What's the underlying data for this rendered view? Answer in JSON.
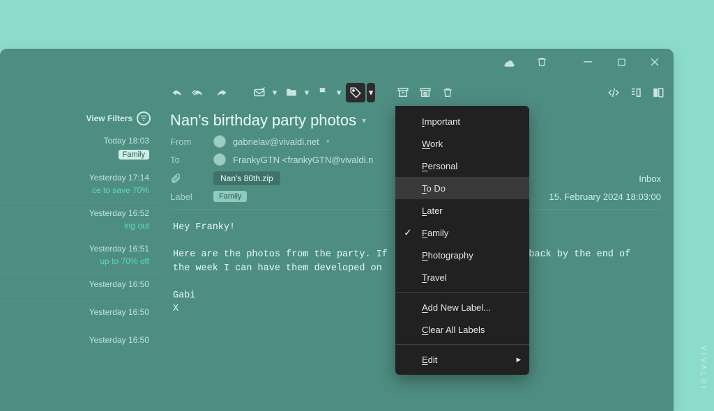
{
  "brand": "VIVALDI",
  "sidebar": {
    "filters_label": "View Filters",
    "items": [
      {
        "time": "Today 18:03",
        "tag": "Family",
        "snippet": ""
      },
      {
        "time": "Yesterday 17:14",
        "tag": "",
        "snippet": "ce to save 70%"
      },
      {
        "time": "Yesterday 16:52",
        "tag": "",
        "snippet": "ing out"
      },
      {
        "time": "Yesterday 16:51",
        "tag": "",
        "snippet": "up to 70% off"
      },
      {
        "time": "Yesterday 16:50",
        "tag": "",
        "snippet": ""
      },
      {
        "time": "Yesterday 16:50",
        "tag": "",
        "snippet": ""
      },
      {
        "time": "Yesterday 16:50",
        "tag": "",
        "snippet": ""
      }
    ]
  },
  "reader": {
    "subject": "Nan's birthday party photos",
    "from_label": "From",
    "from_value": "gabrielav@vivaldi.net",
    "to_label": "To",
    "to_value": "FrankyGTN <frankyGTN@vivaldi.n",
    "attach_name": "Nan's 80th.zip",
    "label_label": "Label",
    "label_value": "Family",
    "folder": "Inbox",
    "date": "15. February 2024 18:03:00",
    "body": "Hey Franky!\n\nHere are the photos from the party. If                         back by the end of\nthe week I can have them developed on\n\nGabi\nX"
  },
  "menu": {
    "items": [
      {
        "key": "I",
        "rest": "mportant"
      },
      {
        "key": "W",
        "rest": "ork"
      },
      {
        "key": "P",
        "rest": "ersonal"
      },
      {
        "key": "T",
        "rest": "o Do",
        "hover": true
      },
      {
        "key": "L",
        "rest": "ater"
      },
      {
        "key": "F",
        "rest": "amily",
        "checked": true
      },
      {
        "key": "P",
        "rest": "hotography"
      },
      {
        "key": "T",
        "rest": "ravel"
      }
    ],
    "add_label": {
      "key": "A",
      "rest": "dd New Label..."
    },
    "clear_label": {
      "key": "C",
      "rest": "lear All Labels"
    },
    "edit_label": {
      "key": "E",
      "rest": "dit"
    }
  }
}
